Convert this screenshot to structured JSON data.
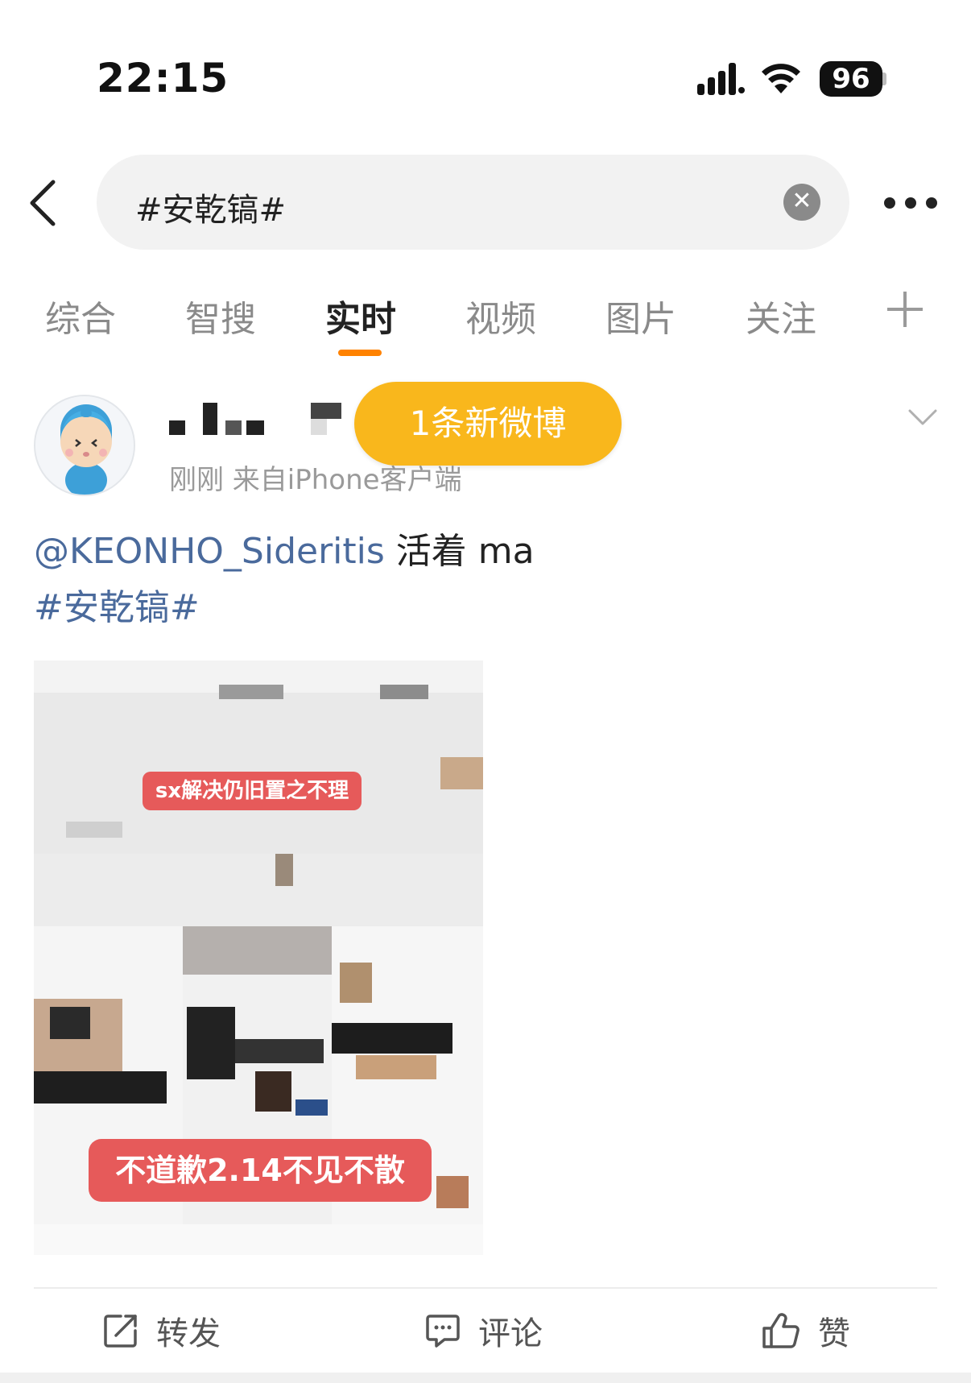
{
  "status_bar": {
    "time": "22:15",
    "battery": "96"
  },
  "search": {
    "query": "#安乾镐#",
    "clear_icon": "close-icon"
  },
  "tabs": [
    {
      "label": "综合",
      "active": false
    },
    {
      "label": "智搜",
      "active": false
    },
    {
      "label": "实时",
      "active": true
    },
    {
      "label": "视频",
      "active": false
    },
    {
      "label": "图片",
      "active": false
    },
    {
      "label": "关注",
      "active": false
    }
  ],
  "accent_color": "#ff8200",
  "post": {
    "meta": "刚刚  来自iPhone客户端",
    "mention": "@KEONHO_Sideritis",
    "text": " 活着 ma",
    "hashtag": "#安乾镐#",
    "image": {
      "banner_top": "sx解决仍旧置之不理",
      "banner_bottom": "不道歉2.14不见不散"
    }
  },
  "new_posts_pill": {
    "label": "1条新微博",
    "color": "#f9b71c"
  },
  "actions": {
    "repost": "转发",
    "comment": "评论",
    "like": "赞"
  }
}
